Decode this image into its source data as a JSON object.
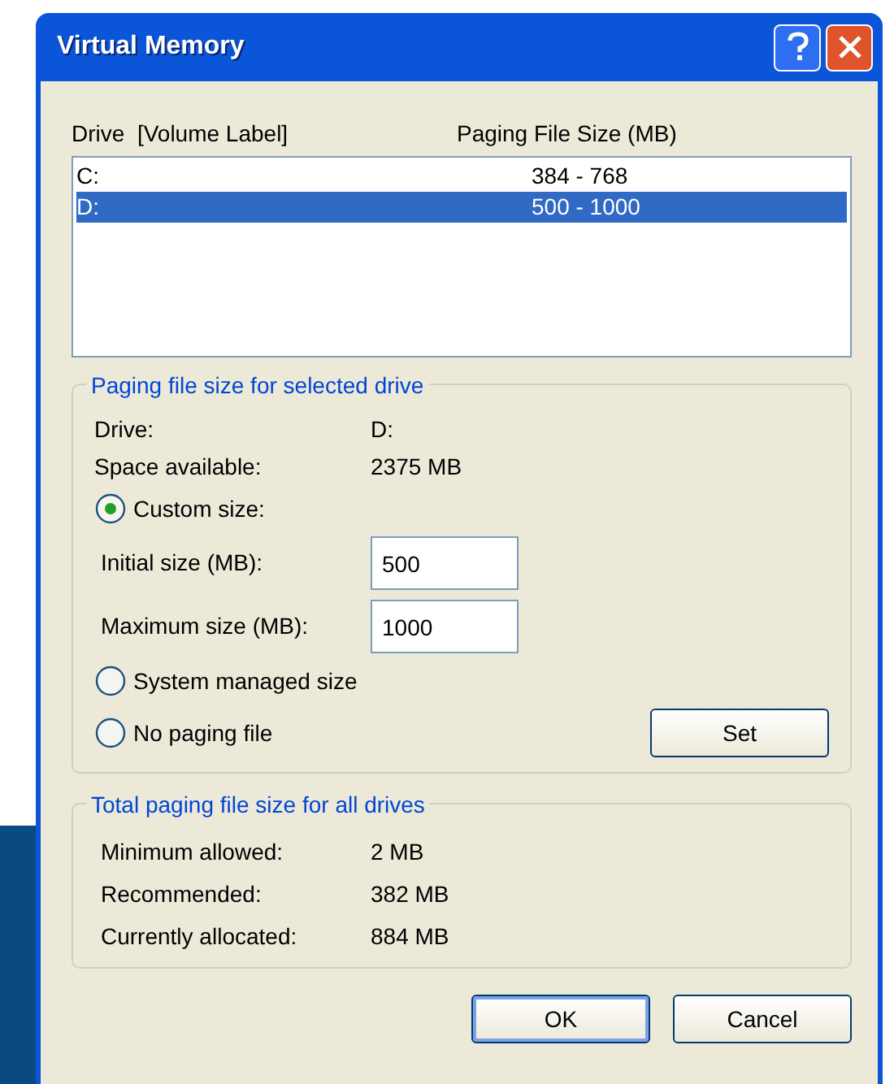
{
  "window": {
    "title": "Virtual Memory"
  },
  "drive_list": {
    "columns": [
      "Drive  [Volume Label]",
      "Paging File Size (MB)"
    ],
    "rows": [
      {
        "drive": "C:",
        "size": "384 - 768",
        "selected": false
      },
      {
        "drive": "D:",
        "size": "500 - 1000",
        "selected": true
      }
    ]
  },
  "selected_drive_group": {
    "title": "Paging file size for selected drive",
    "info": [
      {
        "label": "Drive:",
        "value": "D:"
      },
      {
        "label": "Space available:",
        "value": "2375 MB"
      }
    ],
    "options": [
      {
        "kind": "radio",
        "label": "Custom size:",
        "selected": true
      },
      {
        "kind": "field",
        "label": "Initial size (MB):",
        "value": "500"
      },
      {
        "kind": "field",
        "label": "Maximum size (MB):",
        "value": "1000"
      },
      {
        "kind": "radio",
        "label": "System managed size",
        "selected": false
      },
      {
        "kind": "radio",
        "label": "No paging file",
        "selected": false
      }
    ],
    "set_button": "Set"
  },
  "total_group": {
    "title": "Total paging file size for all drives",
    "rows": [
      {
        "label": "Minimum allowed:",
        "value": "2 MB"
      },
      {
        "label": "Recommended:",
        "value": "382 MB"
      },
      {
        "label": "Currently allocated:",
        "value": "884 MB"
      }
    ]
  },
  "buttons": [
    {
      "label": "OK",
      "default": true
    },
    {
      "label": "Cancel",
      "default": false
    }
  ]
}
